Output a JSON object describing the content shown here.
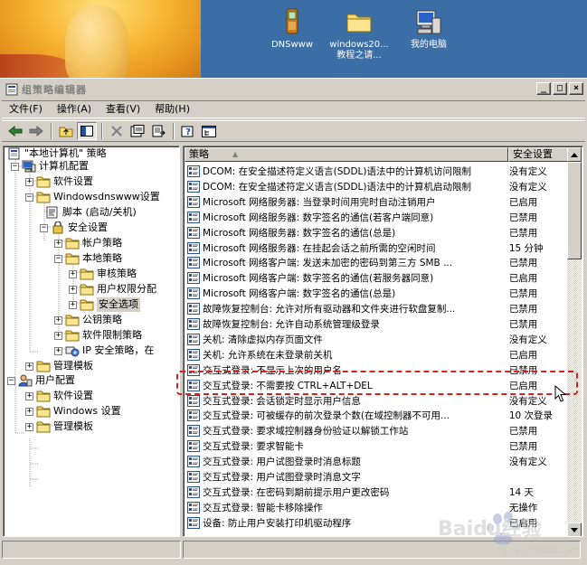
{
  "desktop": {
    "icons": [
      {
        "label": "DNSwww",
        "label2": "",
        "icon": "phone-icon"
      },
      {
        "label": "windows20...",
        "label2": "教程之请...",
        "icon": "folder-icon"
      },
      {
        "label": "我的电脑",
        "label2": "",
        "icon": "my-computer-icon"
      }
    ]
  },
  "window": {
    "title": "组策略编辑器",
    "controls": {
      "minimize": "_",
      "maximize": "□",
      "close": "×"
    }
  },
  "menubar": {
    "items": [
      "文件(F)",
      "操作(A)",
      "查看(V)",
      "帮助(H)"
    ]
  },
  "toolbar": {
    "buttons": [
      "back-icon",
      "forward-icon",
      "up-folder-icon",
      "show-hide-tree-icon",
      "delete-icon",
      "properties-icon",
      "export-list-icon",
      "help-icon",
      "console-icon"
    ]
  },
  "tree": {
    "nodes": [
      {
        "label": "\"本地计算机\" 策略",
        "expander": "",
        "icon": "policy-icon"
      },
      {
        "label": "计算机配置",
        "expander": "−",
        "icon": "computer-icon"
      },
      {
        "label": "软件设置",
        "expander": "+",
        "icon": "folder-icon"
      },
      {
        "label": "Windowsdnswww设置",
        "expander": "−",
        "icon": "folder-icon"
      },
      {
        "label": "脚本 (启动/关机)",
        "expander": "",
        "icon": "script-icon"
      },
      {
        "label": "安全设置",
        "expander": "−",
        "icon": "security-icon"
      },
      {
        "label": "帐户策略",
        "expander": "+",
        "icon": "folder-icon"
      },
      {
        "label": "本地策略",
        "expander": "−",
        "icon": "folder-icon"
      },
      {
        "label": "审核策略",
        "expander": "+",
        "icon": "folder-icon"
      },
      {
        "label": "用户权限分配",
        "expander": "+",
        "icon": "folder-icon"
      },
      {
        "label": "安全选项",
        "expander": "+",
        "icon": "folder-icon",
        "selected": true
      },
      {
        "label": "公钥策略",
        "expander": "+",
        "icon": "folder-icon"
      },
      {
        "label": "软件限制策略",
        "expander": "+",
        "icon": "folder-icon"
      },
      {
        "label": "IP 安全策略，在",
        "expander": "+",
        "icon": "ip-policy-icon"
      },
      {
        "label": "管理模板",
        "expander": "+",
        "icon": "folder-icon"
      },
      {
        "label": "用户配置",
        "expander": "−",
        "icon": "user-icon"
      },
      {
        "label": "软件设置",
        "expander": "+",
        "icon": "folder-icon"
      },
      {
        "label": "Windows 设置",
        "expander": "+",
        "icon": "folder-icon"
      },
      {
        "label": "管理模板",
        "expander": "+",
        "icon": "folder-icon"
      }
    ]
  },
  "list": {
    "columns": [
      "策略",
      "安全设置"
    ],
    "sort_indicator": "▲",
    "rows": [
      {
        "policy": "DCOM: 在安全描述符定义语言(SDDL)语法中的计算机访问限制",
        "setting": "没有定义"
      },
      {
        "policy": "DCOM: 在安全描述符定义语言(SDDL)语法中的计算机启动限制",
        "setting": "没有定义"
      },
      {
        "policy": "Microsoft 网络服务器: 当登录时间用完时自动注销用户",
        "setting": "已启用"
      },
      {
        "policy": "Microsoft 网络服务器: 数字签名的通信(若客户端同意)",
        "setting": "已禁用"
      },
      {
        "policy": "Microsoft 网络服务器: 数字签名的通信(总是)",
        "setting": "已禁用"
      },
      {
        "policy": "Microsoft 网络服务器: 在挂起会话之前所需的空闲时间",
        "setting": "15 分钟"
      },
      {
        "policy": "Microsoft 网络客户端: 发送未加密的密码到第三方 SMB ...",
        "setting": "已禁用"
      },
      {
        "policy": "Microsoft 网络客户端: 数字签名的通信(若服务器同意)",
        "setting": "已启用"
      },
      {
        "policy": "Microsoft 网络客户端: 数字签名的通信(总是)",
        "setting": "已禁用"
      },
      {
        "policy": "故障恢复控制台: 允许对所有驱动器和文件夹进行软盘复制...",
        "setting": "已禁用"
      },
      {
        "policy": "故障恢复控制台: 允许自动系统管理级登录",
        "setting": "已禁用"
      },
      {
        "policy": "关机: 清除虚拟内存页面文件",
        "setting": "没有定义"
      },
      {
        "policy": "关机: 允许系统在未登录前关机",
        "setting": "已启用"
      },
      {
        "policy": "交互式登录: 不显示上次的用户名",
        "setting": "已禁用"
      },
      {
        "policy": "交互式登录: 不需要按 CTRL+ALT+DEL",
        "setting": "已启用",
        "highlight": true
      },
      {
        "policy": "交互式登录: 会话锁定时显示用户信息",
        "setting": "没有定义"
      },
      {
        "policy": "交互式登录: 可被缓存的前次登录个数(在域控制器不可用...",
        "setting": "10 次登录"
      },
      {
        "policy": "交互式登录: 要求域控制器身份验证以解锁工作站",
        "setting": "已禁用"
      },
      {
        "policy": "交互式登录: 要求智能卡",
        "setting": "已禁用"
      },
      {
        "policy": "交互式登录: 用户试图登录时消息标题",
        "setting": "没有定义"
      },
      {
        "policy": "交互式登录: 用户试图登录时消息文字",
        "setting": ""
      },
      {
        "policy": "交互式登录: 在密码到期前提示用户更改密码",
        "setting": "14 天"
      },
      {
        "policy": "交互式登录: 智能卡移除操作",
        "setting": "无操作"
      },
      {
        "policy": "设备: 防止用户安装打印机驱动程序",
        "setting": "已启用"
      }
    ]
  },
  "watermark": {
    "text": "Baidu经验",
    "subtext": "jingyan.baidu.com"
  },
  "colors": {
    "desktop": "#3a6ea5",
    "face": "#d4d0c8",
    "highlight_outline": "#d42020",
    "disabled_title": "#808080"
  }
}
